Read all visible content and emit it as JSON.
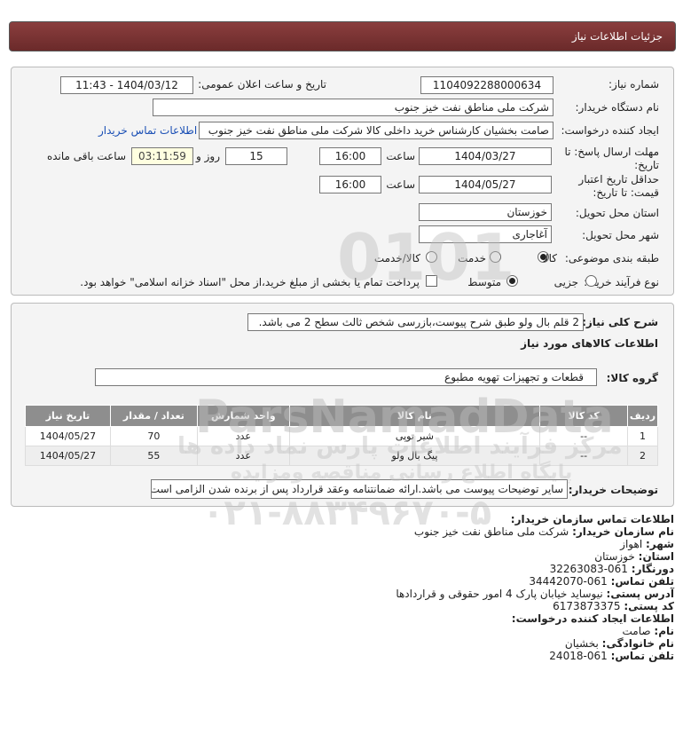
{
  "header": {
    "title": "جزئیات اطلاعات نیاز"
  },
  "need_number": {
    "label": "شماره نیاز:",
    "value": "1104092288000634"
  },
  "announce": {
    "label": "تاریخ و ساعت اعلان عمومی:",
    "value": "1404/03/12 - 11:43"
  },
  "buyer_org": {
    "label": "نام دستگاه خریدار:",
    "value": "شرکت ملی مناطق نفت خیز جنوب"
  },
  "creator": {
    "label": "ایجاد کننده درخواست:",
    "value": "صامت  بخشیان  کارشناس خرید داخلی کالا  شرکت ملی مناطق نفت خیز جنوب",
    "contact_link": "اطلاعات تماس خریدار"
  },
  "deadline": {
    "label": "مهلت ارسال پاسخ: تا تاریخ:",
    "date": "1404/03/27",
    "time_label": "ساعت",
    "time": "16:00",
    "days": "15",
    "days_label": "روز و",
    "remaining": "03:11:59",
    "remaining_label": "ساعت باقی مانده"
  },
  "validity": {
    "label": "حداقل تاریخ اعتبار قیمت: تا تاریخ:",
    "date": "1404/05/27",
    "time_label": "ساعت",
    "time": "16:00"
  },
  "delivery_province": {
    "label": "استان محل تحویل:",
    "value": "خوزستان"
  },
  "delivery_city": {
    "label": "شهر محل تحویل:",
    "value": "آغاجاری"
  },
  "category": {
    "label": "طبقه بندی موضوعی:",
    "options": [
      "کالا",
      "خدمت",
      "کالا/خدمت"
    ],
    "selected": "کالا"
  },
  "process": {
    "label": "نوع فرآیند خرید :",
    "options": [
      "جزیی",
      "متوسط"
    ],
    "selected": "متوسط",
    "payment_note": "پرداخت تمام یا بخشی از مبلغ خرید،از محل \"اسناد خزانه اسلامی\" خواهد بود."
  },
  "description": {
    "label": "شرح کلی نیاز:",
    "value": "2 قلم بال ولو طبق شرح پیوست،بازرسی شخص ثالث سطح 2 می باشد."
  },
  "goods_info": {
    "title": "اطلاعات کالاهای مورد نیاز"
  },
  "goods_group": {
    "label": "گروه کالا:",
    "value": "قطعات و تجهیزات تهویه مطبوع"
  },
  "table": {
    "headers": [
      "ردیف",
      "کد کالا",
      "نام کالا",
      "واحد شمارش",
      "تعداد / مقدار",
      "تاریخ نیاز"
    ],
    "rows": [
      {
        "row": "1",
        "code": "--",
        "name": "شیر توپی",
        "unit": "عدد",
        "qty": "70",
        "date": "1404/05/27"
      },
      {
        "row": "2",
        "code": "--",
        "name": "پیگ بال ولو",
        "unit": "عدد",
        "qty": "55",
        "date": "1404/05/27"
      }
    ]
  },
  "buyer_notes": {
    "label": "توضیحات خریدار:",
    "value": "سایر توضیحات پیوست می باشد.ارائه ضمانتنامه وعقد قرارداد پس از برنده شدن الزامی است"
  },
  "contact": {
    "org_heading": "اطلاعات تماس سازمان خریدار:",
    "buyer_name_label": "نام سازمان خریدار:",
    "buyer_name": "شرکت ملی مناطق نفت خیز جنوب",
    "city_label": "شهر:",
    "city": "اهواز",
    "province_label": "استان:",
    "province": "خوزستان",
    "fax_label": "دورنگار:",
    "fax": "061-32263083",
    "phone_label": "تلفن تماس:",
    "phone": "061-34442070",
    "address_label": "آدرس پستی:",
    "address": "نیوساید خیابان پارک 4 امور حقوقی و قراردادها",
    "postal_label": "کد پستی:",
    "postal": "6173873375",
    "creator_heading": "اطلاعات ایجاد کننده درخواست:",
    "first_name_label": "نام:",
    "first_name": "صامت",
    "last_name_label": "نام خانوادگی:",
    "last_name": "بخشیان",
    "creator_phone_label": "تلفن تماس:",
    "creator_phone": "061-24018"
  },
  "watermark": {
    "brand": "ParsNamadData",
    "line1": "مرکز فرآیند اطلاعات پارس نماد داده ها",
    "line2": "پایگاه اطلاع رسانی مناقصه ومزایده",
    "phone": "۰۲۱-۸۸۳۴۹۶۷۰-۵",
    "digits": "0101"
  },
  "colors": {
    "title_bar": "#7a3333",
    "link": "#1a4fb5",
    "table_header": "#8e8e8e",
    "timer_bg": "#ffffe0"
  }
}
